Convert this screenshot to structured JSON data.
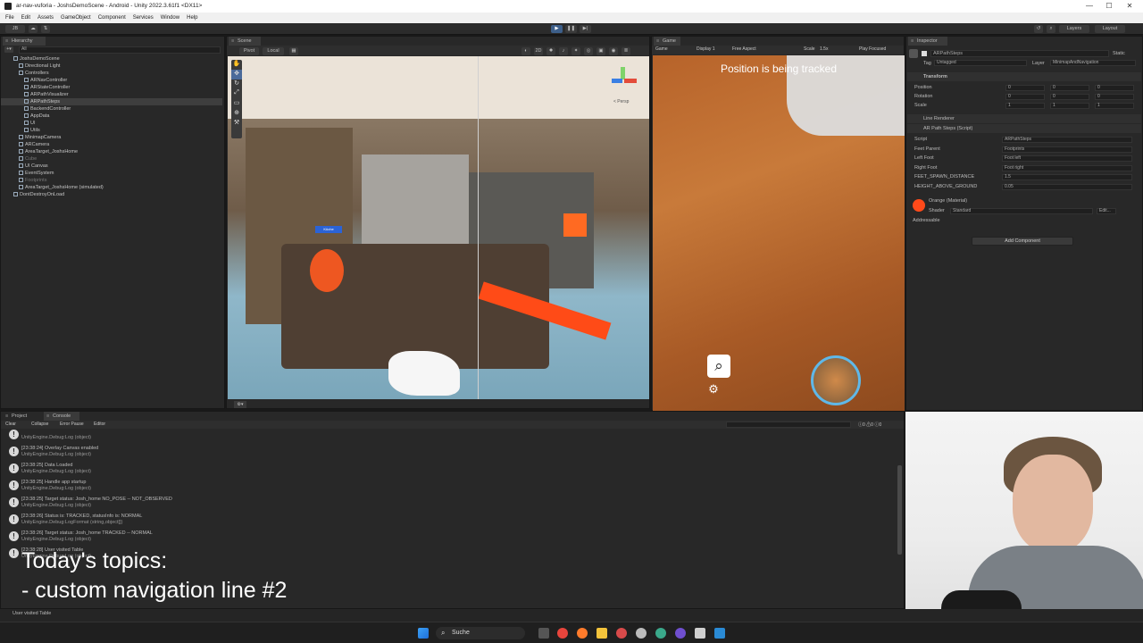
{
  "window": {
    "title": "ar-nav-vuforia - JoshsDemoScene - Android - Unity 2022.3.61f1 <DX11>",
    "minimize": "—",
    "maximize": "☐",
    "close": "✕"
  },
  "menu": [
    "File",
    "Edit",
    "Assets",
    "GameObject",
    "Component",
    "Services",
    "Window",
    "Help"
  ],
  "toolbar": {
    "account": "JB",
    "layers": "Layers",
    "layout": "Layout"
  },
  "hierarchy": {
    "tab": "Hierarchy",
    "search_placeholder": "All",
    "items": [
      {
        "label": "JoshsDemoScene",
        "indent": 0,
        "dim": false,
        "sel": false
      },
      {
        "label": "Directional Light",
        "indent": 1,
        "dim": false,
        "sel": false
      },
      {
        "label": "Controllers",
        "indent": 1,
        "dim": false,
        "sel": false
      },
      {
        "label": "ARNavController",
        "indent": 2,
        "dim": false,
        "sel": false
      },
      {
        "label": "ARStateController",
        "indent": 2,
        "dim": false,
        "sel": false
      },
      {
        "label": "ARPathVisualizer",
        "indent": 2,
        "dim": false,
        "sel": false
      },
      {
        "label": "ARPathSteps",
        "indent": 2,
        "dim": false,
        "sel": true
      },
      {
        "label": "BackendController",
        "indent": 2,
        "dim": false,
        "sel": false
      },
      {
        "label": "AppData",
        "indent": 2,
        "dim": false,
        "sel": false
      },
      {
        "label": "UI",
        "indent": 2,
        "dim": false,
        "sel": false
      },
      {
        "label": "Utils",
        "indent": 2,
        "dim": false,
        "sel": false
      },
      {
        "label": "MinimapCamera",
        "indent": 1,
        "dim": false,
        "sel": false
      },
      {
        "label": "ARCamera",
        "indent": 1,
        "dim": false,
        "sel": false
      },
      {
        "label": "AreaTarget_JoshsHome",
        "indent": 1,
        "dim": false,
        "sel": false
      },
      {
        "label": "Cube",
        "indent": 1,
        "dim": true,
        "sel": false
      },
      {
        "label": "UI Canvas",
        "indent": 1,
        "dim": false,
        "sel": false
      },
      {
        "label": "EventSystem",
        "indent": 1,
        "dim": false,
        "sel": false
      },
      {
        "label": "Footprints",
        "indent": 1,
        "dim": true,
        "sel": false
      },
      {
        "label": "AreaTarget_JoshsHome (simulated)",
        "indent": 1,
        "dim": false,
        "sel": false
      },
      {
        "label": "DontDestroyOnLoad",
        "indent": 0,
        "dim": false,
        "sel": false
      }
    ]
  },
  "scene": {
    "tab": "Scene",
    "pivot": "Pivot",
    "local": "Local",
    "persp": "< Persp",
    "mode_2d": "2D",
    "label_sign": "Küche"
  },
  "game": {
    "tab": "Game",
    "display": "Display 1",
    "aspect": "Free Aspect",
    "scale_label": "Scale",
    "scale_value": "1.5x",
    "play_focused": "Play Focused",
    "overlay_text": "Position is being tracked"
  },
  "inspector": {
    "tab": "Inspector",
    "object_name": "ARPathSteps",
    "static": "Static",
    "tag_label": "Tag",
    "tag_value": "Untagged",
    "layer_label": "Layer",
    "layer_value": "MinimapAndNavigation",
    "transform": {
      "title": "Transform",
      "rows": [
        {
          "label": "Position",
          "x": "0",
          "y": "0",
          "z": "0"
        },
        {
          "label": "Rotation",
          "x": "0",
          "y": "0",
          "z": "0"
        },
        {
          "label": "Scale",
          "x": "1",
          "y": "1",
          "z": "1"
        }
      ]
    },
    "line_renderer": "Line Renderer",
    "script_component": "AR Path Steps (Script)",
    "script_rows": [
      {
        "label": "Script",
        "value": "ARPathSteps"
      },
      {
        "label": "Feet Parent",
        "value": "Footprints"
      },
      {
        "label": "Left Foot",
        "value": "Foot left"
      },
      {
        "label": "Right Foot",
        "value": "Foot right"
      },
      {
        "label": "FEET_SPAWN_DISTANCE",
        "value": "1.5"
      },
      {
        "label": "HEIGHT_ABOVE_GROUND",
        "value": "0.05"
      }
    ],
    "material_name": "Orange (Material)",
    "shader_label": "Shader",
    "shader_value": "Standard",
    "edit_label": "Edit...",
    "addressable": "Addressable",
    "add_component": "Add Component"
  },
  "console": {
    "tabs": [
      "Project",
      "Console"
    ],
    "buttons": [
      "Clear",
      "Collapse",
      "Error Pause",
      "Editor"
    ],
    "entries": [
      {
        "line1": "",
        "line2": "UnityEngine.Debug:Log (object)"
      },
      {
        "line1": "[23:38:24] Overlay Canvas enabled",
        "line2": "UnityEngine.Debug:Log (object)"
      },
      {
        "line1": "[23:38:25] Data Loaded",
        "line2": "UnityEngine.Debug:Log (object)"
      },
      {
        "line1": "[23:38:25] Handle app startup",
        "line2": "UnityEngine.Debug:Log (object)"
      },
      {
        "line1": "[23:38:25] Target status: Josh_home NO_POSE -- NOT_OBSERVED",
        "line2": "UnityEngine.Debug:Log (object)"
      },
      {
        "line1": "[23:38:26] Status is: TRACKED, statusInfo is: NORMAL",
        "line2": "UnityEngine.Debug:LogFormat (string,object[])"
      },
      {
        "line1": "[23:38:26] Target status: Josh_home TRACKED -- NORMAL",
        "line2": "UnityEngine.Debug:Log (object)"
      },
      {
        "line1": "[23:38:28] User visited Table",
        "line2": "UnityEngine.Debug:Log (object)"
      }
    ],
    "status_bar": "User visited Table"
  },
  "caption": {
    "line1": "Today's topics:",
    "line2": "- custom navigation line #2"
  },
  "taskbar": {
    "search_label": "Suche"
  },
  "colors": {
    "accent": "#ff5a1f",
    "selection": "#3e3e3e",
    "panel": "#282828"
  }
}
